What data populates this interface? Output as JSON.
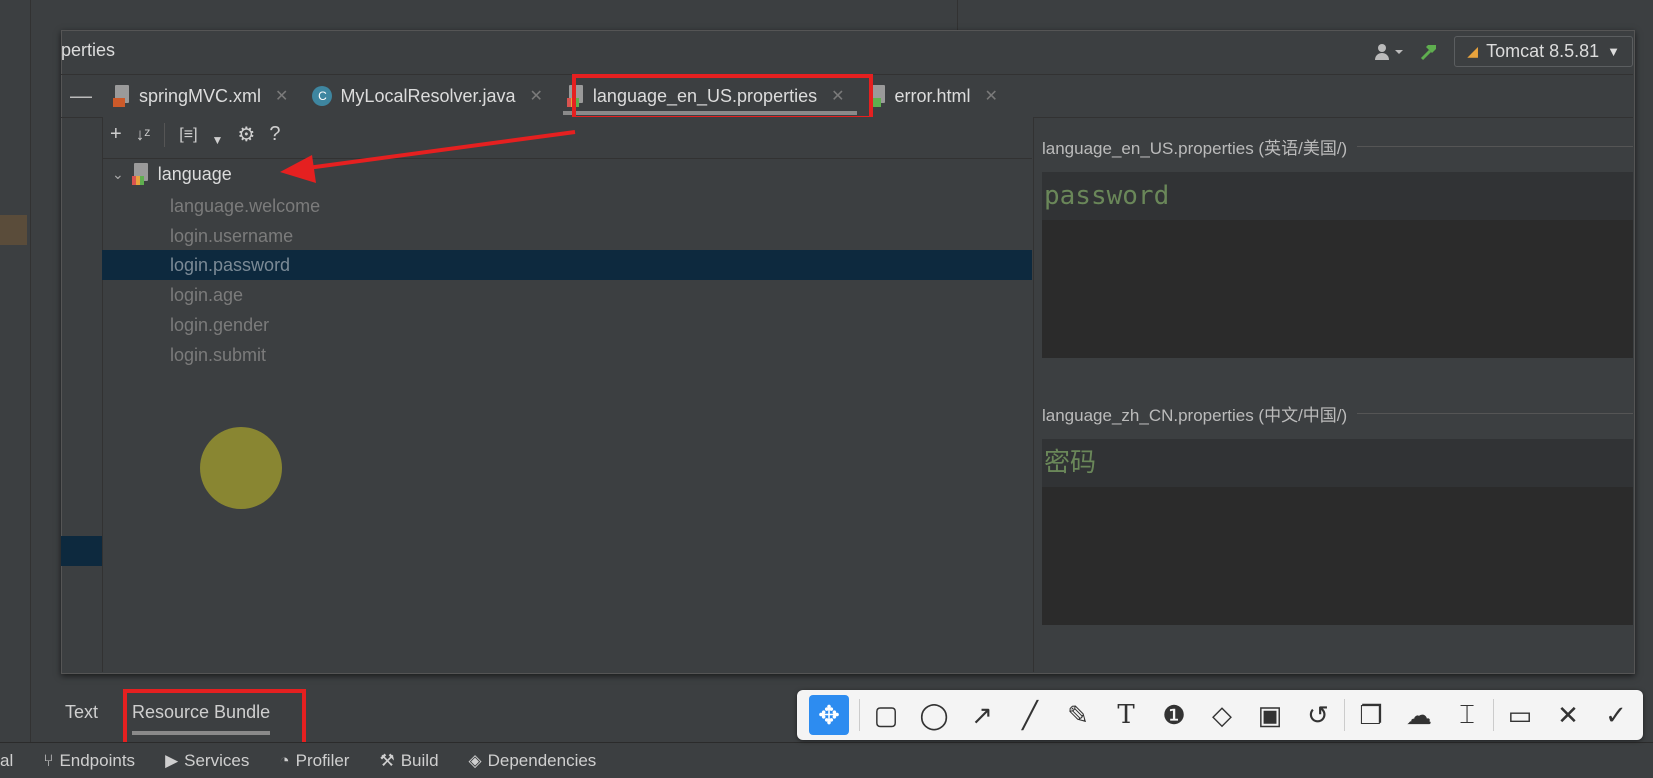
{
  "window": {
    "title": "perties"
  },
  "toolbar_right": {
    "run_config": "Tomcat 8.5.81"
  },
  "tabs": [
    {
      "label": "springMVC.xml"
    },
    {
      "label": "MyLocalResolver.java",
      "icon_letter": "C"
    },
    {
      "label": "language_en_US.properties",
      "active": true
    },
    {
      "label": "error.html"
    }
  ],
  "tree": {
    "root": "language",
    "keys": [
      "language.welcome",
      "login.username",
      "login.password",
      "login.age",
      "login.gender",
      "login.submit"
    ],
    "selected": "login.password"
  },
  "values": [
    {
      "file_label": "language_en_US.properties (英语/美国/)",
      "value": "password"
    },
    {
      "file_label": "language_zh_CN.properties (中文/中国/)",
      "value": "密码"
    }
  ],
  "editor_tabs": {
    "text": "Text",
    "resource_bundle": "Resource Bundle"
  },
  "statusbar": [
    {
      "label": "al"
    },
    {
      "label": "Endpoints"
    },
    {
      "label": "Services"
    },
    {
      "label": "Profiler"
    },
    {
      "label": "Build"
    },
    {
      "label": "Dependencies"
    }
  ],
  "colors": {
    "highlight_red": "#e52020",
    "selection": "#0d293e",
    "value_green": "#6a8759",
    "annot_blue": "#2d8cf0"
  },
  "annotation_tools": [
    "move-icon",
    "rectangle-icon",
    "ellipse-icon",
    "arrow-icon",
    "line-icon",
    "pen-icon",
    "text-icon",
    "number-icon",
    "eraser-icon",
    "mosaic-icon",
    "undo-icon",
    "copy-icon",
    "upload-icon",
    "ocr-icon",
    "save-icon",
    "close-icon",
    "confirm-icon"
  ]
}
